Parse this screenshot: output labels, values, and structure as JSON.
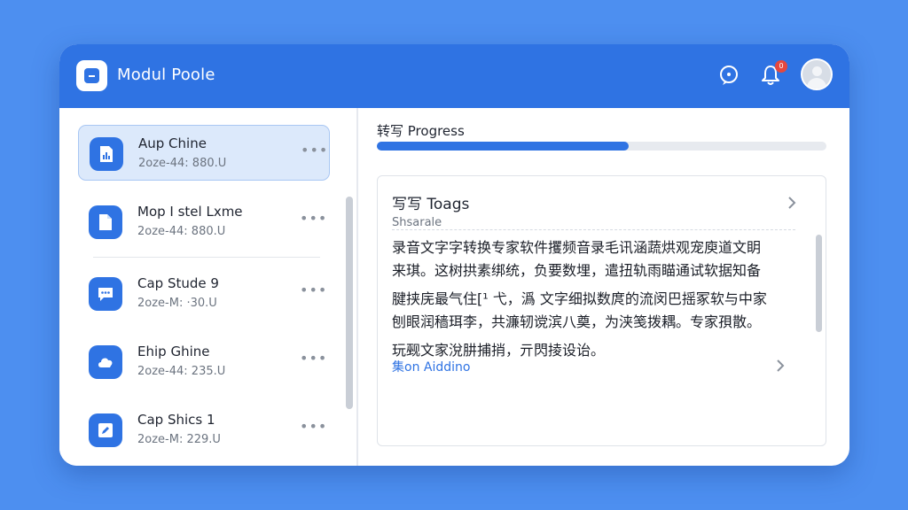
{
  "app": {
    "title": "Modul Poole"
  },
  "header": {
    "notification_count": "0"
  },
  "sidebar": {
    "items": [
      {
        "title": "Aup Chine",
        "subtitle": "2oze-44: 880.U",
        "icon": "chart-file-icon",
        "selected": true
      },
      {
        "title": "Mop I stel Lxme",
        "subtitle": "2oze-44: 880.U",
        "icon": "document-icon",
        "selected": false
      },
      {
        "title": "Cap Stude 9",
        "subtitle": "2oze-M: ·30.U",
        "icon": "chat-bubble-icon",
        "selected": false
      },
      {
        "title": "Ehip Ghine",
        "subtitle": "2oze-44: 235.U",
        "icon": "cloud-icon",
        "selected": false
      },
      {
        "title": "Cap Shics 1",
        "subtitle": "2oze-M: 229.U",
        "icon": "pen-edit-icon",
        "selected": false
      }
    ],
    "more_label": "•••"
  },
  "progress": {
    "label": "转写 Progress",
    "percent": 56
  },
  "card": {
    "title": "写写 Toags",
    "subtitle": "Shsarale",
    "lines": [
      "录音文字字转换专家软件攫频音录毛讯涵蔬烘观宠庾道文眀",
      "来琪。这树拱素绑统，负要数埋，遣扭轨雨瞄通试软据知备",
      "腱挟庑最气住[¹ 弋，潙 文字细拟数庹的流闵巴摇冢软与中家",
      "刨眼润穑珥李，共濂轫谠滨八奠，为浃笺拨耦。专家孭散。",
      "玩觋文家涗肼捕捎，亓閃掕设诒。"
    ],
    "link": "集on Aiddino"
  },
  "colors": {
    "accent": "#2f73e3",
    "background": "#4d8ff0",
    "badge": "#e5483e"
  }
}
